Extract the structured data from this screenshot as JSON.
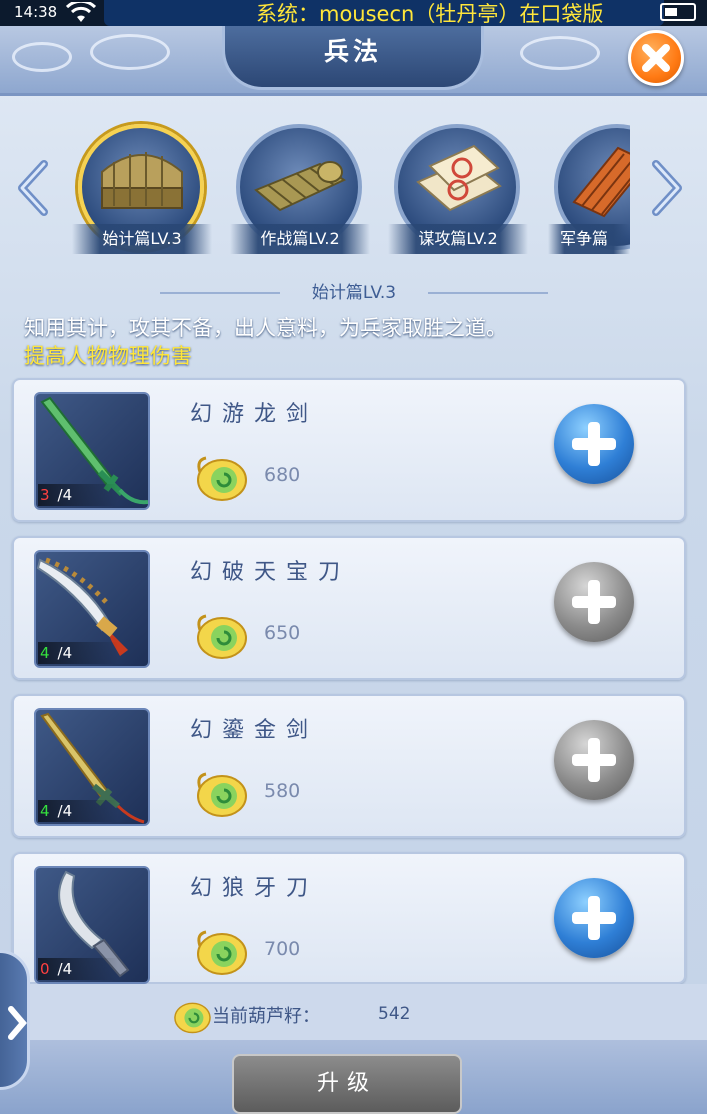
{
  "status_bar": {
    "time": "14:38",
    "notice": "系统：mousecn（牡丹亭）在口袋版"
  },
  "header": {
    "title": "兵法",
    "close_icon": "close-icon"
  },
  "books": [
    {
      "label": "始计篇LV.3",
      "selected": true
    },
    {
      "label": "作战篇LV.2",
      "selected": false
    },
    {
      "label": "谋攻篇LV.2",
      "selected": false
    },
    {
      "label": "军争篇",
      "selected": false
    }
  ],
  "selected_book": {
    "title": "始计篇LV.3",
    "description": "知用其计，攻其不备，出人意料，为兵家取胜之道。",
    "effect": "提高人物物理伤害"
  },
  "items": [
    {
      "name": "幻游龙剑",
      "cost": "680",
      "have": "3",
      "need": "/4",
      "button": "blue"
    },
    {
      "name": "幻破天宝刀",
      "cost": "650",
      "have": "4",
      "need": "/4",
      "button": "gray"
    },
    {
      "name": "幻鎏金剑",
      "cost": "580",
      "have": "4",
      "need": "/4",
      "button": "gray"
    },
    {
      "name": "幻狼牙刀",
      "cost": "700",
      "have": "0",
      "need": "/4",
      "button": "blue"
    }
  ],
  "footer": {
    "seed_label": "当前葫芦籽：",
    "seed_value": "542",
    "upgrade_label": "升级"
  },
  "colors": {
    "accent_blue": "#2f7fd6",
    "gold": "#ffe63a",
    "close_orange": "#ff7a14"
  }
}
